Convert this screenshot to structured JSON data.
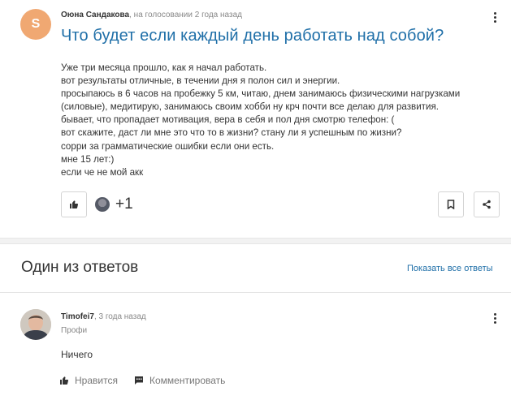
{
  "question": {
    "avatar_letter": "S",
    "author": "Оюна Сандакова",
    "meta": ", на голосовании 2 года назад",
    "title": "Что будет если каждый день работать над собой?",
    "body_lines": [
      "Уже три месяца прошло, как я начал работать.",
      "вот результаты отличные, в течении дня я полон сил и энергии.",
      "просыпаюсь в 6 часов на пробежку 5 км, читаю, днем занимаюсь физическими нагрузками",
      "(силовые), медитирую, занимаюсь своим хобби ну крч почти все делаю для развития.",
      "бывает, что пропадает мотивация, вера в себя и пол дня смотрю телефон: (",
      "вот скажите, даст ли мне это что то в жизни? стану ли я успешным по жизни?",
      "сорри за грамматические ошибки если они есть.",
      "мне 15 лет:)",
      "если че не мой акк"
    ],
    "likers_extra": "+1"
  },
  "answers_section": {
    "title": "Один из ответов",
    "show_all": "Показать все ответы"
  },
  "answer": {
    "author": "Timofei7",
    "meta": ", 3 года назад",
    "rank": "Профи",
    "text": "Ничего",
    "like_label": "Нравится",
    "comment_label": "Комментировать"
  },
  "colors": {
    "accent": "#1f6fa8",
    "avatar_bg": "#f0a872"
  },
  "icons": [
    "thumbs-up-icon",
    "bookmark-icon",
    "share-icon",
    "more-vertical-icon",
    "comment-icon"
  ]
}
